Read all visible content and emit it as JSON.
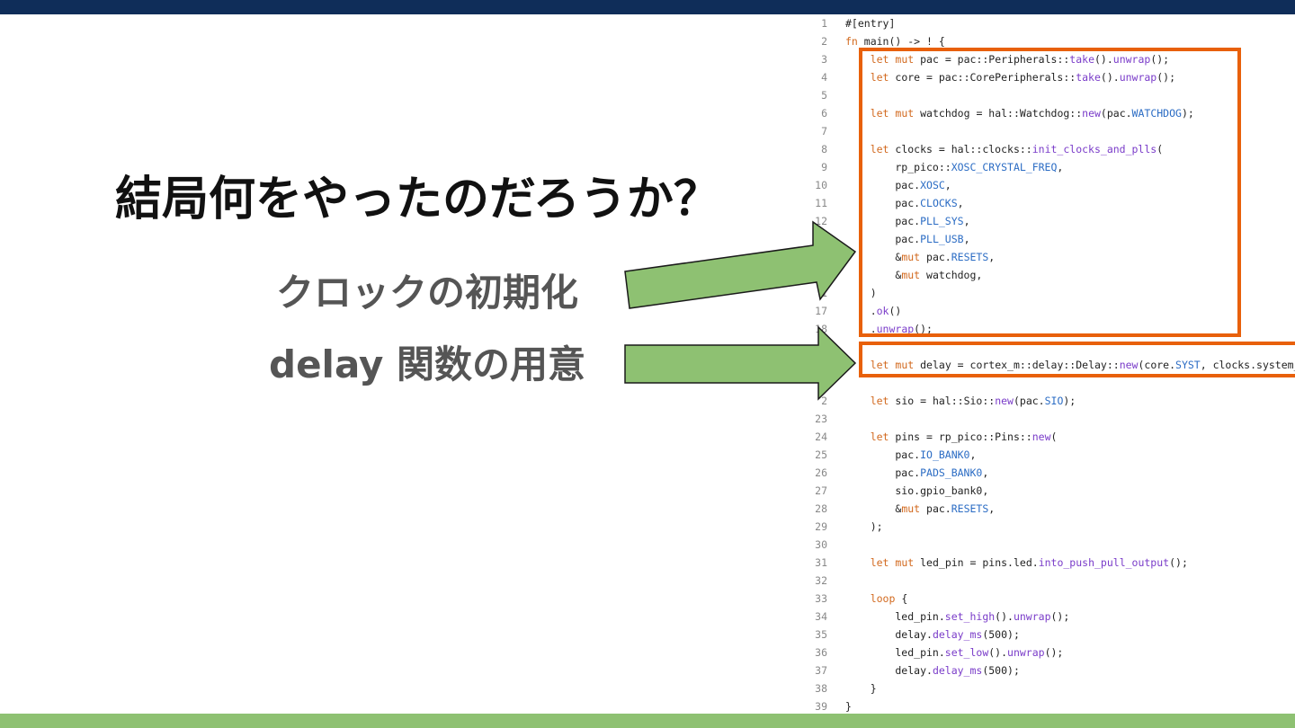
{
  "slide": {
    "title": "結局何をやったのだろうか？",
    "bullets": [
      "クロックの初期化",
      "delay 関数の用意"
    ]
  },
  "colors": {
    "top_bar": "#0f2d59",
    "bottom_bar": "#8ec172",
    "highlight": "#e8600a",
    "arrow_fill": "#8ec172",
    "keyword": "#d2691e",
    "method": "#7a3cc9",
    "constant": "#2b6cc4"
  },
  "code": {
    "lines": [
      {
        "n": "1",
        "t": "#[entry]"
      },
      {
        "n": "2",
        "t": "fn main() -> ! {"
      },
      {
        "n": "3",
        "t": "    let mut pac = pac::Peripherals::take().unwrap();"
      },
      {
        "n": "4",
        "t": "    let core = pac::CorePeripherals::take().unwrap();"
      },
      {
        "n": "5",
        "t": ""
      },
      {
        "n": "6",
        "t": "    let mut watchdog = hal::Watchdog::new(pac.WATCHDOG);"
      },
      {
        "n": "7",
        "t": ""
      },
      {
        "n": "8",
        "t": "    let clocks = hal::clocks::init_clocks_and_plls("
      },
      {
        "n": "9",
        "t": "        rp_pico::XOSC_CRYSTAL_FREQ,"
      },
      {
        "n": "10",
        "t": "        pac.XOSC,"
      },
      {
        "n": "11",
        "t": "        pac.CLOCKS,"
      },
      {
        "n": "12",
        "t": "        pac.PLL_SYS,"
      },
      {
        "n": "",
        "t": "        pac.PLL_USB,"
      },
      {
        "n": "",
        "t": "        &mut pac.RESETS,"
      },
      {
        "n": "",
        "t": "        &mut watchdog,"
      },
      {
        "n": "1",
        "t": "    )"
      },
      {
        "n": "17",
        "t": "    .ok()"
      },
      {
        "n": "18",
        "t": "    .unwrap();"
      },
      {
        "n": "",
        "t": ""
      },
      {
        "n": "",
        "t": "    let mut delay = cortex_m::delay::Delay::new(core.SYST, clocks.system_clo"
      },
      {
        "n": "",
        "t": ""
      },
      {
        "n": "2",
        "t": "    let sio = hal::Sio::new(pac.SIO);"
      },
      {
        "n": "23",
        "t": ""
      },
      {
        "n": "24",
        "t": "    let pins = rp_pico::Pins::new("
      },
      {
        "n": "25",
        "t": "        pac.IO_BANK0,"
      },
      {
        "n": "26",
        "t": "        pac.PADS_BANK0,"
      },
      {
        "n": "27",
        "t": "        sio.gpio_bank0,"
      },
      {
        "n": "28",
        "t": "        &mut pac.RESETS,"
      },
      {
        "n": "29",
        "t": "    );"
      },
      {
        "n": "30",
        "t": ""
      },
      {
        "n": "31",
        "t": "    let mut led_pin = pins.led.into_push_pull_output();"
      },
      {
        "n": "32",
        "t": ""
      },
      {
        "n": "33",
        "t": "    loop {"
      },
      {
        "n": "34",
        "t": "        led_pin.set_high().unwrap();"
      },
      {
        "n": "35",
        "t": "        delay.delay_ms(500);"
      },
      {
        "n": "36",
        "t": "        led_pin.set_low().unwrap();"
      },
      {
        "n": "37",
        "t": "        delay.delay_ms(500);"
      },
      {
        "n": "38",
        "t": "    }"
      },
      {
        "n": "39",
        "t": "}"
      }
    ]
  }
}
